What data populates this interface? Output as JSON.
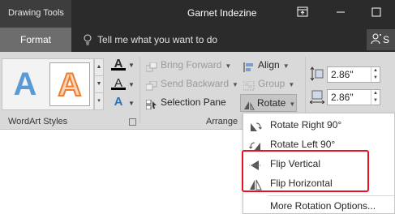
{
  "titlebar": {
    "context_label": "Drawing Tools",
    "doc_title": "Garnet Indezine"
  },
  "tabs": {
    "format": "Format",
    "tell_me": "Tell me what you want to do",
    "share_initial": "S"
  },
  "ribbon": {
    "wordart_group_label": "WordArt Styles",
    "arrange_group_label": "Arrange",
    "arrange": {
      "bring_forward": "Bring Forward",
      "send_backward": "Send Backward",
      "selection_pane": "Selection Pane",
      "align": "Align",
      "group": "Group",
      "rotate": "Rotate"
    },
    "size": {
      "height": "2.86\"",
      "width": "2.86\""
    }
  },
  "rotate_menu": {
    "items": [
      {
        "label": "Rotate Right 90°",
        "icon": "rotate-right-icon"
      },
      {
        "label": "Rotate Left 90°",
        "icon": "rotate-left-icon"
      },
      {
        "label": "Flip Vertical",
        "icon": "flip-vertical-icon"
      },
      {
        "label": "Flip Horizontal",
        "icon": "flip-horizontal-icon"
      }
    ],
    "more": "More Rotation Options..."
  },
  "colors": {
    "titlebar": "#2b2b2b",
    "active_tab": "#6d6d6d",
    "ribbon": "#d9d9d9",
    "highlight": "#e81123",
    "wordart_blue": "#5b9bd5",
    "wordart_orange": "#ed7d31"
  }
}
